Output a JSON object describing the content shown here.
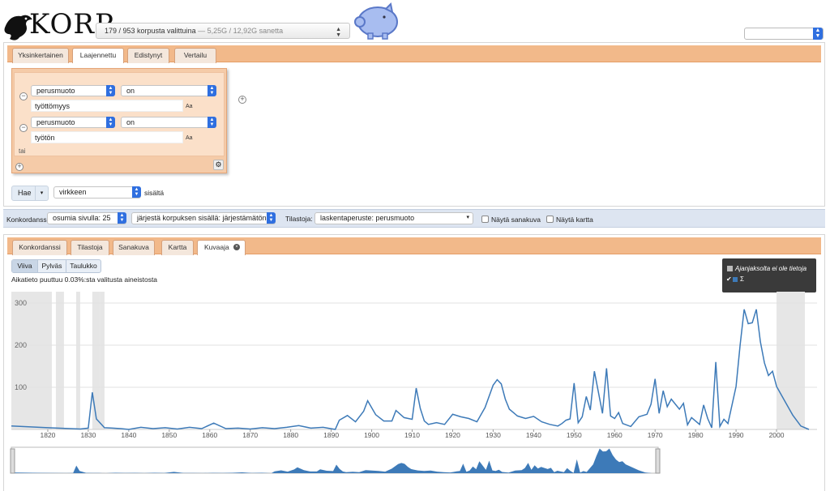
{
  "header": {
    "logo_text": "KORP",
    "corpus_selector": {
      "count": "179 / 953 korpusta valittuina",
      "tokens": " — 5,25G / 12,92G sanetta"
    }
  },
  "search_tabs": [
    "Yksinkertainen",
    "Laajennettu",
    "Edistynyt",
    "Vertailu"
  ],
  "query": {
    "rows": [
      {
        "attribute": "perusmuoto",
        "operator": "on",
        "value": "työttömyys",
        "case_label": "Aa"
      },
      {
        "attribute": "perusmuoto",
        "operator": "on",
        "value": "työtön",
        "case_label": "Aa"
      }
    ],
    "or_label": "tai"
  },
  "search_bar": {
    "button": "Hae",
    "scope": "virkkeen",
    "scope_suffix": "sisältä"
  },
  "toolbar": {
    "konkordanssi_label": "Konkordanssi:",
    "hits_per_page": "osumia sivulla: 25",
    "sort": "järjestä korpuksen sisällä: järjestämätön",
    "stats_label": "Tilastoja:",
    "stats_base": "laskentaperuste: perusmuoto",
    "show_wordpic": "Näytä sanakuva",
    "show_map": "Näytä kartta"
  },
  "result_tabs": [
    "Konkordanssi",
    "Tilastoja",
    "Sanakuva",
    "Kartta",
    "Kuvaaja"
  ],
  "chart_view": {
    "modes": [
      "Viiva",
      "Pylväs",
      "Taulukko"
    ],
    "missing_note": "Aikatieto puuttuu 0.03%:sta valitusta aineistosta",
    "legend": {
      "no_data": "Ajanjaksolta ei ole tietoja",
      "sum": "Σ"
    }
  },
  "colors": {
    "accent_orange": "#f2b98a",
    "series": "#3d7ab8",
    "toolbar": "#dde5f1"
  },
  "chart_data": {
    "type": "line",
    "xlim": [
      1811,
      2010
    ],
    "ylim": [
      0,
      300
    ],
    "yticks": [
      100,
      200,
      300
    ],
    "xticks": [
      1820,
      1830,
      1840,
      1850,
      1860,
      1870,
      1880,
      1890,
      1900,
      1910,
      1920,
      1930,
      1940,
      1950,
      1960,
      1970,
      1980,
      1990,
      2000
    ],
    "no_data_ranges": [
      [
        1811,
        1821
      ],
      [
        1822,
        1824
      ],
      [
        1827,
        1828
      ],
      [
        1831,
        1833
      ],
      [
        1833,
        1834
      ],
      [
        2000,
        2007
      ]
    ],
    "series": [
      {
        "name": "Σ",
        "x": [
          1811,
          1820,
          1828,
          1830,
          1831,
          1832,
          1834,
          1836,
          1838,
          1840,
          1843,
          1846,
          1849,
          1852,
          1855,
          1858,
          1861,
          1864,
          1867,
          1870,
          1873,
          1876,
          1879,
          1882,
          1885,
          1888,
          1891,
          1892,
          1894,
          1896,
          1898,
          1899,
          1901,
          1903,
          1905,
          1906,
          1908,
          1910,
          1911,
          1912,
          1913,
          1914,
          1916,
          1918,
          1920,
          1922,
          1924,
          1926,
          1928,
          1930,
          1931,
          1932,
          1933,
          1934,
          1936,
          1938,
          1940,
          1942,
          1944,
          1946,
          1947,
          1948,
          1949,
          1950,
          1951,
          1952,
          1953,
          1954,
          1955,
          1957,
          1958,
          1959,
          1960,
          1961,
          1962,
          1964,
          1966,
          1968,
          1969,
          1970,
          1971,
          1972,
          1973,
          1974,
          1976,
          1977,
          1978,
          1979,
          1981,
          1982,
          1983,
          1984,
          1985,
          1986,
          1987,
          1988,
          1990,
          1991,
          1992,
          1993,
          1994,
          1995,
          1996,
          1997,
          1998,
          1999,
          2000,
          2002,
          2004,
          2006,
          2008
        ],
        "values": [
          8,
          4,
          1,
          3,
          88,
          25,
          4,
          3,
          2,
          0,
          5,
          2,
          4,
          1,
          5,
          2,
          15,
          2,
          3,
          1,
          4,
          2,
          5,
          9,
          3,
          5,
          0,
          22,
          33,
          18,
          43,
          68,
          35,
          20,
          20,
          45,
          28,
          24,
          98,
          50,
          20,
          12,
          16,
          12,
          36,
          30,
          26,
          18,
          52,
          105,
          118,
          108,
          72,
          48,
          32,
          26,
          31,
          18,
          12,
          8,
          14,
          22,
          25,
          110,
          16,
          30,
          78,
          46,
          138,
          38,
          145,
          32,
          26,
          40,
          14,
          7,
          30,
          36,
          60,
          120,
          38,
          92,
          54,
          72,
          48,
          62,
          11,
          28,
          12,
          58,
          26,
          4,
          160,
          7,
          24,
          14,
          102,
          200,
          285,
          251,
          253,
          285,
          208,
          158,
          128,
          138,
          102,
          68,
          34,
          8,
          0
        ]
      }
    ]
  }
}
